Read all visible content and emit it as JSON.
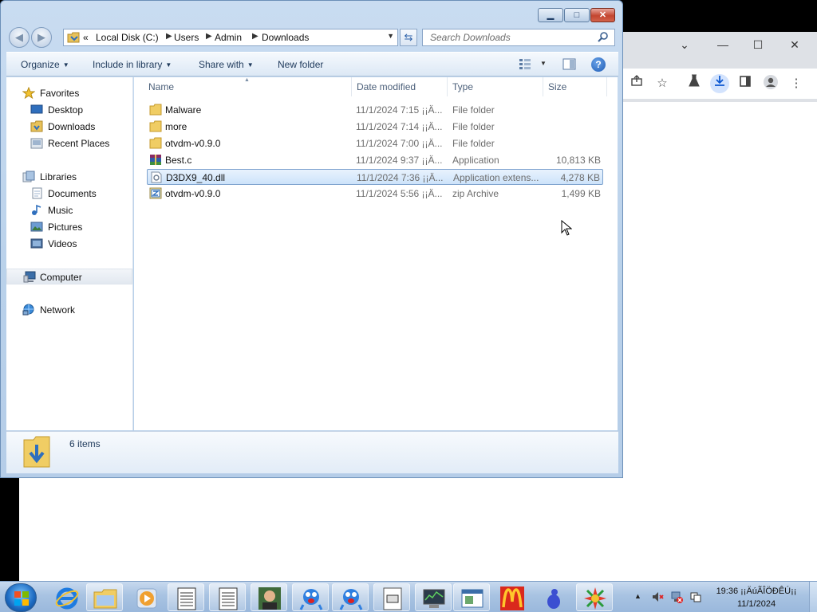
{
  "explorer": {
    "address": {
      "overflow": "«",
      "crumbs": [
        "Local Disk (C:)",
        "Users",
        "Admin",
        "Downloads"
      ]
    },
    "search": {
      "placeholder": "Search Downloads"
    },
    "toolbar": {
      "organize": "Organize",
      "include_in_library": "Include in library",
      "share_with": "Share with",
      "new_folder": "New folder"
    },
    "nav": {
      "favorites": "Favorites",
      "desktop": "Desktop",
      "downloads": "Downloads",
      "recent_places": "Recent Places",
      "libraries": "Libraries",
      "documents": "Documents",
      "music": "Music",
      "pictures": "Pictures",
      "videos": "Videos",
      "computer": "Computer",
      "network": "Network"
    },
    "columns": {
      "name": "Name",
      "date": "Date modified",
      "type": "Type",
      "size": "Size"
    },
    "files": [
      {
        "name": "Malware",
        "date": "11/1/2024 7:15 ¡¡Ä...",
        "type": "File folder",
        "size": "",
        "icon": "folder-icon"
      },
      {
        "name": "more",
        "date": "11/1/2024 7:14 ¡¡Ä...",
        "type": "File folder",
        "size": "",
        "icon": "folder-icon"
      },
      {
        "name": "otvdm-v0.9.0",
        "date": "11/1/2024 7:00 ¡¡Ä...",
        "type": "File folder",
        "size": "",
        "icon": "folder-icon"
      },
      {
        "name": "Best.c",
        "date": "11/1/2024 9:37 ¡¡Ä...",
        "type": "Application",
        "size": "10,813 KB",
        "icon": "winrar-icon"
      },
      {
        "name": "D3DX9_40.dll",
        "date": "11/1/2024 7:36 ¡¡Ä...",
        "type": "Application extens...",
        "size": "4,278 KB",
        "icon": "dll-icon",
        "selected": true
      },
      {
        "name": "otvdm-v0.9.0",
        "date": "11/1/2024 5:56 ¡¡Ä...",
        "type": "zip Archive",
        "size": "1,499 KB",
        "icon": "zip-icon"
      }
    ],
    "status": {
      "item_count": "6 items"
    }
  },
  "taskbar": {
    "clock_time": "19:36 ¡¡ÄúÃÎÖÐÊÚ¡¡",
    "clock_date": "11/1/2024"
  },
  "colors": {
    "selection_border": "#7da2ce",
    "taskbar": "#a8c3e2",
    "explorer_frame": "#b9d1ea"
  }
}
